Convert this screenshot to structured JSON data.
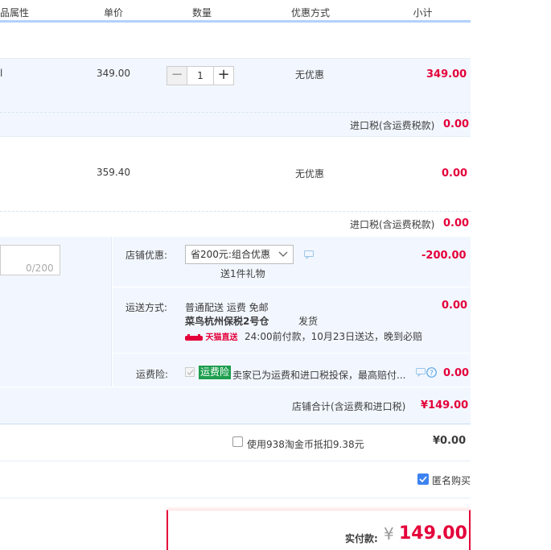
{
  "header": {
    "col_attr": "品属性",
    "col_price": "单价",
    "col_qty": "数量",
    "col_discount": "优惠方式",
    "col_subtotal": "小计"
  },
  "items": [
    {
      "prefix": "l",
      "price": "349.00",
      "quantity": "1",
      "discount": "无优惠",
      "subtotal": "349.00",
      "tax_label": "进口税(含运费税款)",
      "tax_value": "0.00"
    },
    {
      "price": "359.40",
      "discount": "无优惠",
      "subtotal": "0.00",
      "tax_label": "进口税(含运费税款)",
      "tax_value": "0.00"
    }
  ],
  "shop": {
    "memo_counter": "0/200",
    "promo_label": "店铺优惠:",
    "promo_select": "省200元:组合优惠",
    "gift_text": "送1件礼物",
    "promo_value": "-200.00",
    "shipping_label": "运送方式:",
    "shipping_method": "普通配送 运费 免邮",
    "warehouse": "菜鸟杭州保税2号仓",
    "warehouse_suffix": "发货",
    "tmall_badge": "天猫直送",
    "delivery_promise": "24:00前付款，10月23日送达，晚到必赔",
    "shipping_value": "0.00",
    "insurance_label": "运费险:",
    "insurance_tag": "运费险",
    "insurance_text": "卖家已为运费和进口税投保，最高赔付...",
    "insurance_value": "0.00",
    "total_label": "店铺合计(含运费和进口税)",
    "total_value": "¥149.00"
  },
  "coins": {
    "label": "使用938淘金币抵扣9.38元",
    "value": "¥0.00"
  },
  "anonymous": {
    "label": "匿名购买",
    "checked": true
  },
  "payment": {
    "label": "实付款:",
    "currency": "¥",
    "amount": "149.00"
  },
  "colors": {
    "accent_blue": "#b2d1ff",
    "price_red": "#e4003a",
    "insurance_green": "#1c9e4d"
  }
}
